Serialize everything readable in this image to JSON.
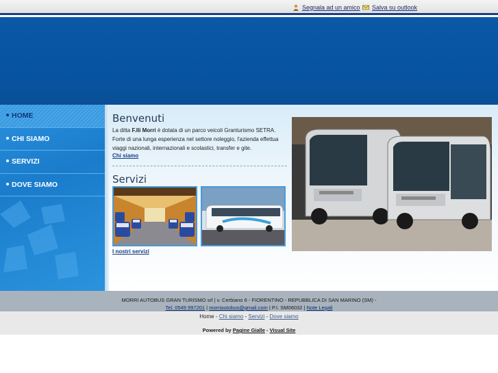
{
  "top": {
    "friend_label": "Segnala ad un amico",
    "outlook_label": "Salva su outlook"
  },
  "nav": {
    "items": [
      {
        "label": "HOME"
      },
      {
        "label": "CHI SIAMO"
      },
      {
        "label": "SERVIZI"
      },
      {
        "label": "DOVE SIAMO"
      }
    ]
  },
  "welcome": {
    "title": "Benvenuti",
    "text_before": "La ditta ",
    "company": "F.lli Morri",
    "text_after": " è dotata di un parco veicoli Granturismo SETRA. Forte di una lunga esperienza nel settore noleggio, l'azienda effettua viaggi nazionali, internazionali e scolastici, transfer e gite.",
    "link": "Chi siamo"
  },
  "services": {
    "title": "Servizi",
    "link": "I nostri servizi"
  },
  "footer": {
    "line1": "MORRI AUTOBUS GRAN TURISMO srl | v. Cerbiano 6 - FIORENTINO - REPUBBLICA DI SAN MARINO (SM) -",
    "phone": "Tel. 0549 997201",
    "sep1": " | ",
    "email": "morriautobus@gmail.com",
    "vat": " | P.I. SM06032 | ",
    "legal": "Note Legali",
    "nav_home": "Home",
    "nav_chisiamo": "Chi siamo",
    "nav_servizi": "Servizi",
    "nav_dove": "Dove siamo",
    "nav_sep": " - ",
    "powered_label": "Powered by ",
    "powered_pg": "Pagine Gialle",
    "powered_dash": " - ",
    "powered_vs": "Visual Site"
  },
  "colors": {
    "header_blue": "#0753a1",
    "sidebar_blue": "#1a7ccb",
    "link_blue": "#1a3f86"
  }
}
